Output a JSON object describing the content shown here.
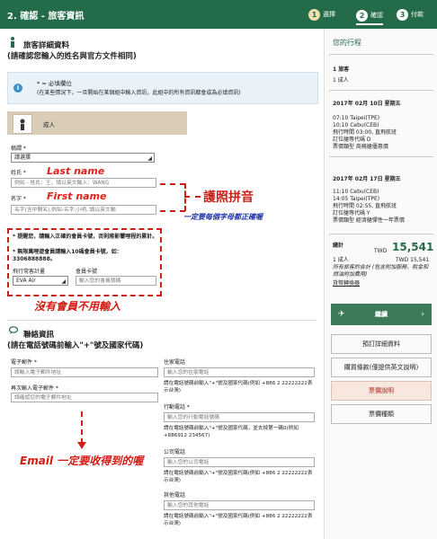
{
  "header": {
    "title": "2. 確認 - 旅客資訊",
    "steps": [
      {
        "num": "1",
        "label": "選擇"
      },
      {
        "num": "2",
        "label": "確認"
      },
      {
        "num": "3",
        "label": "付款"
      }
    ]
  },
  "traveler_section": {
    "title": "旅客詳細資料",
    "subtitle": "(請確認您輸入的姓名與官方文件相同)",
    "notice_line1": "* = 必填欄位",
    "notice_line2": "(在某些情況下，一旦開始在某個組中輸入資訊，此組中的所有資訊都會成為必填資訊)",
    "passenger_label": "成人",
    "title_label": "稱謂 *",
    "title_value": "請選擇",
    "surname_label": "姓氏 *",
    "surname_placeholder": "例如 - 姓氏：王，請以英文輸入：WANG",
    "givenname_label": "名字 *",
    "givenname_placeholder": "名字(含中間名),例如-名字:小明, 請以英文輸",
    "ff_note1": "* 提醒您，請輸入正確的會員卡號，否則將影響哩程的累計。",
    "ff_note2": "* 無限萬哩遊會員請輸入10碼會員卡號，如：3306888888。",
    "ff_program_label": "飛行常客計畫",
    "ff_program_value": "EVA Air",
    "ff_card_label": "會員卡號",
    "ff_card_placeholder": "輸入您的會員號碼"
  },
  "annotations": {
    "last_name": "Last name",
    "first_name": "First name",
    "passport_pinyin": "護照拼音",
    "capitals_note": "一定要每個字母都正確喔",
    "no_member": "沒有會員不用輸入",
    "email_note": "Email 一定要收得到的喔"
  },
  "contact_section": {
    "title": "聯絡資訊",
    "subtitle": "(請在電話號碼前輸入\"+\"號及國家代碼)",
    "email_label": "電子郵件 *",
    "email_placeholder": "請輸入電子郵件地址",
    "email2_label": "再次輸入電子郵件 *",
    "email2_placeholder": "請確認您的電子郵件地址",
    "home_label": "住家電話",
    "home_placeholder": "輸入您的住家電話",
    "home_hint": "請在電話號碼前輸入\"+\"號及國家代碼(例如 +886 2 22222222表示台灣)",
    "mobile_label": "行動電話 *",
    "mobile_placeholder": "輸入您的行動電話號碼",
    "mobile_hint": "請在電話號碼前輸入\"+\"號及國家代碼，並去掉第一碼0(例如 +886912 234567)",
    "office_label": "公司電話",
    "office_placeholder": "輸入您的公司電話",
    "office_hint": "請在電話號碼前輸入\"+\"號及國家代碼(例如 +886 2 22222222表示台灣)",
    "other_label": "其他電話",
    "other_placeholder": "輸入您的其他電話",
    "other_hint": "請在電話號碼前輸入\"+\"號及國家代碼(例如 +886 2 22222222表示台灣)"
  },
  "sidebar": {
    "heading": "您的行程",
    "pax_count": "1 旅客",
    "pax_type": "1 成人",
    "out_date": "2017年 02月 10日 星期五",
    "out_dep": "07:10 Taipei(TPE)",
    "out_arr": "10:10 Cebu(CEB)",
    "out_dur": "飛行時間 03:00, 直飛航班",
    "out_class": "訂位艙等代碼 D",
    "out_fare": "票價類型 商務艙優惠價",
    "ret_date": "2017年 02月 17日 星期五",
    "ret_dep": "11:10 Cebu(CEB)",
    "ret_arr": "14:05 Taipei(TPE)",
    "ret_dur": "飛行時間 02:55, 直飛航班",
    "ret_class": "訂位艙等代碼 Y",
    "ret_fare": "票價類型 經濟艙彈性一年票價",
    "total_label": "總計",
    "total_currency": "TWD",
    "total_amount": "15,541",
    "pax_line": "1 成人",
    "pax_amount": "TWD 15,541",
    "tax_note": "所有旅客的合計 (包含附加服務、稅金和燃油附加費用)",
    "converter": "貨幣轉換器",
    "continue": "繼續",
    "btn_details": "預訂詳細資料",
    "btn_purchase": "購買條款(僅提供英文說明)",
    "btn_fare_rules": "票價說明",
    "btn_fare_type": "票價種類"
  }
}
